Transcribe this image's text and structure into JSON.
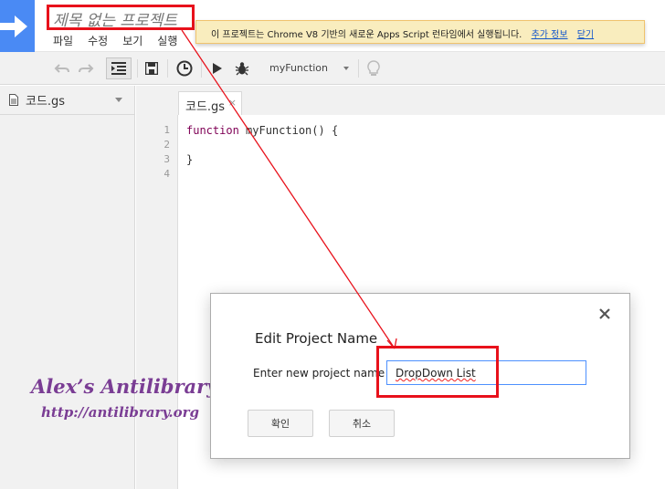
{
  "header": {
    "project_title": "제목 없는 프로젝트",
    "menu": [
      "파일",
      "수정",
      "보기",
      "실행"
    ]
  },
  "notice": {
    "text": "이 프로젝트는 Chrome V8 기반의 새로운 Apps Script 런타임에서 실행됩니다.",
    "more_info": "추가 정보",
    "dismiss": "닫기"
  },
  "toolbar": {
    "function_select": "myFunction",
    "icons": [
      "undo-icon",
      "redo-icon",
      "indent-icon",
      "save-icon",
      "clock-icon",
      "run-icon",
      "debug-icon",
      "lightbulb-icon"
    ]
  },
  "sidebar": {
    "file_name": "코드.gs"
  },
  "editor": {
    "tab_name": "코드.gs",
    "tab_close": "×",
    "line_numbers": [
      "1",
      "2",
      "3",
      "4"
    ],
    "code_line1_keyword": "function",
    "code_line1_rest": " myFunction() {",
    "code_line3": "}"
  },
  "dialog": {
    "title": "Edit Project Name",
    "label": "Enter new project name",
    "input_value": "DropDown List",
    "ok_button": "확인",
    "cancel_button": "취소"
  },
  "watermark": {
    "name": "Alex’s Antilibrary",
    "url": "http://antilibrary.org"
  },
  "colors": {
    "annotation_red": "#e8111b",
    "logo_blue": "#4a8af4",
    "notice_bg": "#f9edbe",
    "watermark_purple": "#7a3d94"
  }
}
